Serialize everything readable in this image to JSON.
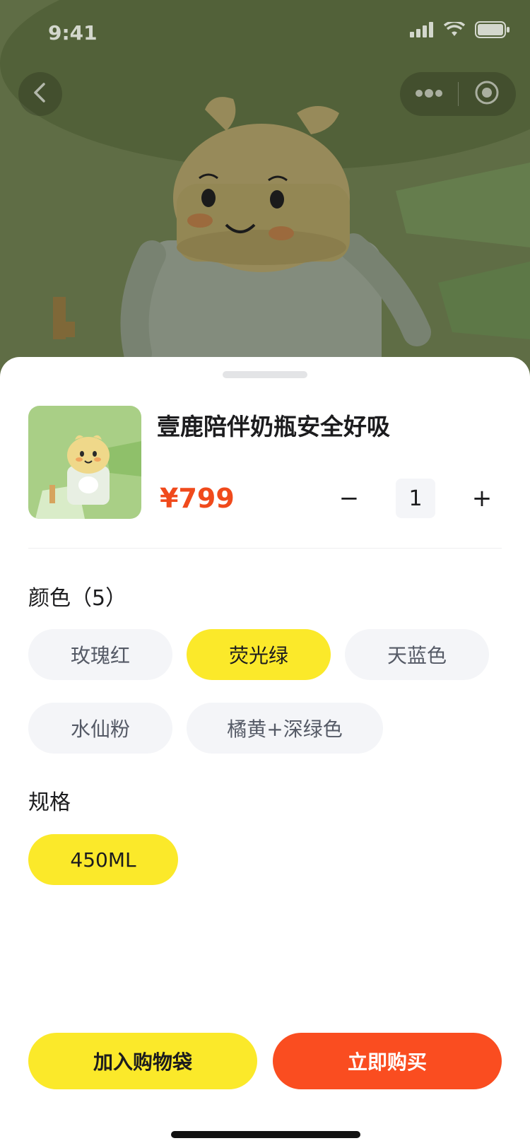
{
  "status_bar": {
    "time": "9:41"
  },
  "product": {
    "title": "壹鹿陪伴奶瓶安全好吸",
    "price": "¥799",
    "quantity": "1",
    "minus_label": "−",
    "plus_label": "+"
  },
  "colors_section": {
    "label": "颜色（5）",
    "options": [
      "玫瑰红",
      "荧光绿",
      "天蓝色",
      "水仙粉",
      "橘黄+深绿色"
    ],
    "selected": "荧光绿"
  },
  "spec_section": {
    "label": "规格",
    "options": [
      "450ML"
    ],
    "selected": "450ML"
  },
  "actions": {
    "add_to_bag": "加入购物袋",
    "buy_now": "立即购买"
  },
  "theme": {
    "accent_yellow": "#fbe92a",
    "accent_orange": "#fa4d20",
    "price_color": "#f04a1c"
  },
  "icons": {
    "back": "chevron-left-icon",
    "more": "more-dots-icon",
    "close_mini": "target-circle-icon",
    "signal": "signal-icon",
    "wifi": "wifi-icon",
    "battery": "battery-icon"
  }
}
